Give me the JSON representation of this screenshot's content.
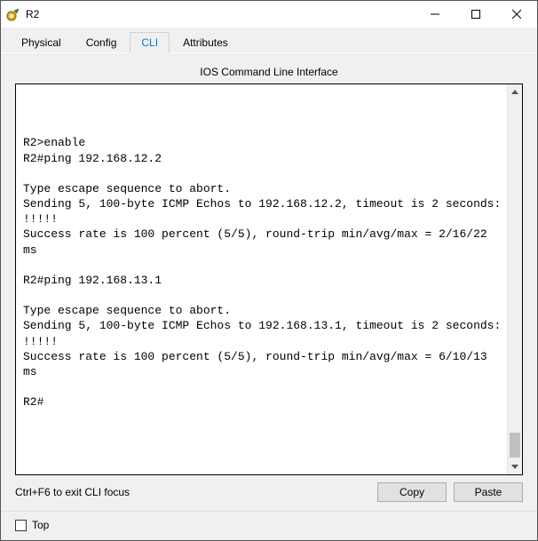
{
  "window": {
    "title": "R2"
  },
  "tabs": [
    "Physical",
    "Config",
    "CLI",
    "Attributes"
  ],
  "active_tab_index": 2,
  "panel": {
    "title": "IOS Command Line Interface"
  },
  "terminal_text": "\n\n\nR2>enable\nR2#ping 192.168.12.2\n\nType escape sequence to abort.\nSending 5, 100-byte ICMP Echos to 192.168.12.2, timeout is 2 seconds:\n!!!!!\nSuccess rate is 100 percent (5/5), round-trip min/avg/max = 2/16/22 ms\n\nR2#ping 192.168.13.1\n\nType escape sequence to abort.\nSending 5, 100-byte ICMP Echos to 192.168.13.1, timeout is 2 seconds:\n!!!!!\nSuccess rate is 100 percent (5/5), round-trip min/avg/max = 6/10/13 ms\n\nR2#",
  "buttons": {
    "copy": "Copy",
    "paste": "Paste"
  },
  "hint": "Ctrl+F6 to exit CLI focus",
  "footer": {
    "top_label": "Top",
    "top_checked": false
  }
}
